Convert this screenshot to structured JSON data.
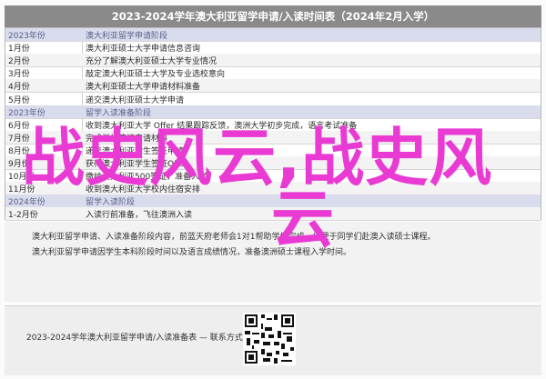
{
  "header": {
    "title": "2023-2024学年澳大利亚留学申请/入读时间表（2024年2月入学）"
  },
  "rows": [
    {
      "type": "section",
      "date": "2023年份",
      "desc": "澳大利亚留学申请阶段"
    },
    {
      "type": "normal",
      "date": "1月份",
      "desc": "澳大利亚硕士大学申请信息咨询"
    },
    {
      "type": "normal",
      "date": "2月份",
      "desc": "充分了解澳大利亚硕士大学专业情况"
    },
    {
      "type": "normal",
      "date": "3月份",
      "desc": "敲定澳大利亚硕士大学及专业选校意向"
    },
    {
      "type": "normal",
      "date": "4月份",
      "desc": "澳大利亚硕士大学申请材料准备"
    },
    {
      "type": "normal",
      "date": "5月份",
      "desc": "递交澳大利亚硕士大学申请"
    },
    {
      "type": "section",
      "date": "2023年份",
      "desc": "留学入读准备阶段"
    },
    {
      "type": "normal",
      "date": "6月份",
      "desc": "收到澳大利亚大学 Offer 结果跟踪反馈，澳洲大学初步完成，语言考试准备"
    },
    {
      "type": "normal",
      "date": "7月份",
      "desc": "完成学生签证申请材料"
    },
    {
      "type": "normal",
      "date": "8月份",
      "desc": "递交澳大利亚学生签证申请"
    },
    {
      "type": "normal",
      "date": "9月份",
      "desc": "获得澳大利亚学生签证Offer"
    },
    {
      "type": "normal",
      "date": "10月份",
      "desc": "缴纳澳大利亚500签证，准备入学"
    },
    {
      "type": "normal",
      "date": "11月份",
      "desc": "收到澳大利亚大学校内住宿安排"
    },
    {
      "type": "section",
      "date": "2024年份",
      "desc": "留学入读阶段"
    },
    {
      "type": "normal",
      "date": "1-2月份",
      "desc": "入读行前准备，飞往澳洲入读"
    }
  ],
  "notes": [
    "澳大利亚留学申请、入读准备阶段内容，前蓝天府老师会1对1帮助学生完成，以便于同学们赴澳入读硕士课程。",
    "澳大利亚留学申请因学生本科阶段时间以及语言成绩情况，准备澳洲硕士课程入学时间。"
  ],
  "footer": {
    "text": "2023-2024学年澳大利亚留学申请/入读准备表 — 联系方式张老师："
  },
  "watermark": {
    "line1": "战史风云,战史风",
    "line2": "云"
  },
  "colors": {
    "section_bg": "#d9dcec",
    "title_bg": "#8a8a8a",
    "watermark": "#e93bd4"
  }
}
